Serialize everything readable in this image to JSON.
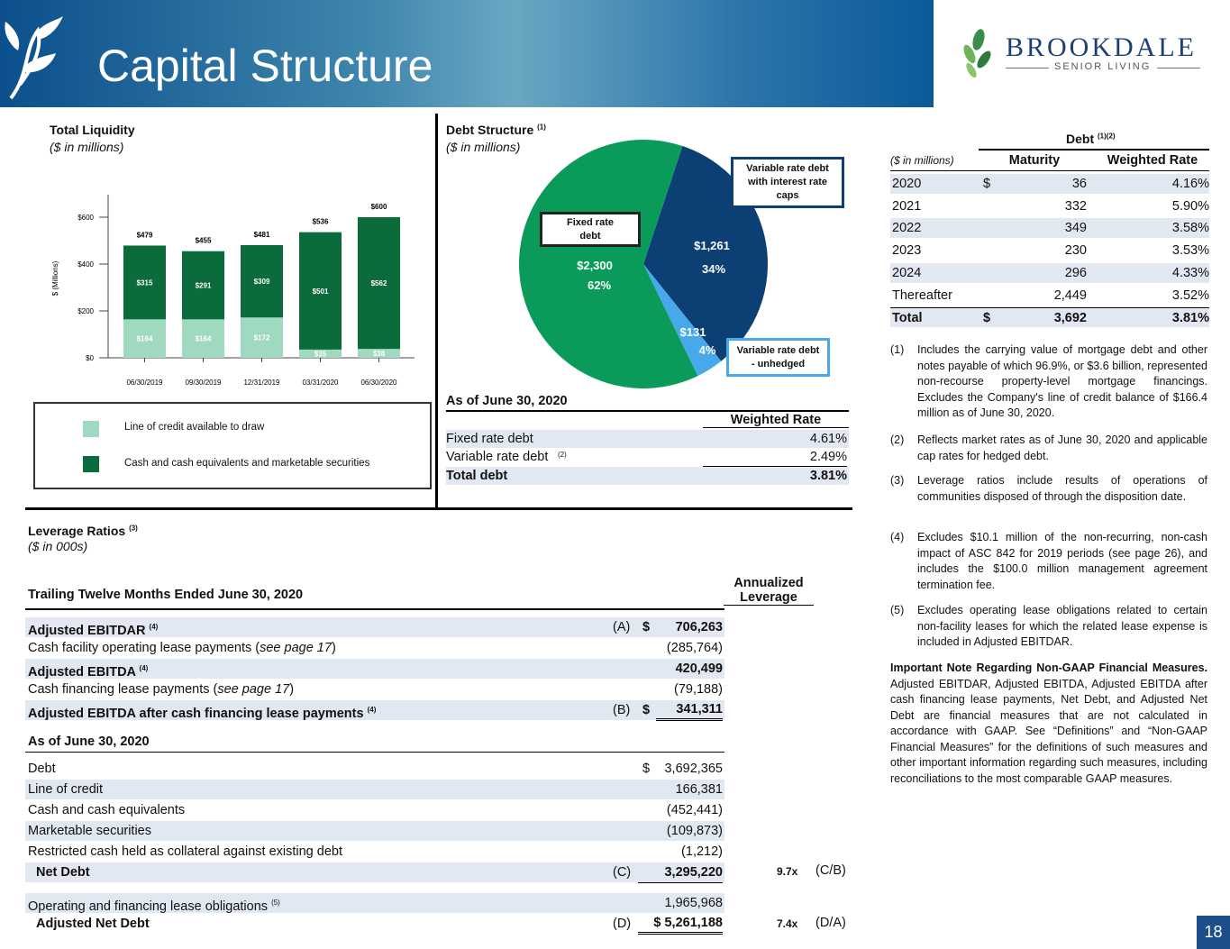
{
  "header": {
    "title": "Capital Structure",
    "brand_name": "BROOKDALE",
    "brand_sub": "SENIOR LIVING"
  },
  "liquidity": {
    "title": "Total Liquidity",
    "units": "($ in millions)",
    "legend_credit": "Line of credit available to draw",
    "legend_cash": "Cash and cash equivalents and marketable securities",
    "ylabel": "$ (Millions)"
  },
  "chart_data": [
    {
      "type": "bar",
      "title": "Total Liquidity",
      "ylabel": "$ (Millions)",
      "ylim": [
        0,
        600
      ],
      "yticks": [
        "$0",
        "$200",
        "$400",
        "$600"
      ],
      "categories": [
        "06/30/2019",
        "09/30/2019",
        "12/31/2019",
        "03/31/2020",
        "06/30/2020"
      ],
      "totals": [
        "$479",
        "$455",
        "$481",
        "$536",
        "$600"
      ],
      "total_values": [
        479,
        455,
        481,
        536,
        600
      ],
      "series": [
        {
          "name": "Line of credit available to draw",
          "values": [
            164,
            164,
            172,
            35,
            38
          ],
          "labels": [
            "$164",
            "$164",
            "$172",
            "$35",
            "$38"
          ],
          "color": "#9fd9bf"
        },
        {
          "name": "Cash and cash equivalents and marketable securities",
          "values": [
            315,
            291,
            309,
            501,
            562
          ],
          "labels": [
            "$315",
            "$291",
            "$309",
            "$501",
            "$562"
          ],
          "color": "#0b6b3a"
        }
      ],
      "stack_order": [
        "Line of credit available to draw",
        "Cash and cash equivalents and marketable securities"
      ]
    },
    {
      "type": "pie",
      "title": "Debt Structure",
      "slices": [
        {
          "name": "Fixed rate debt",
          "value": 2300,
          "label": "$2,300",
          "pct": "62%",
          "color": "#0a9b5a"
        },
        {
          "name": "Variable rate debt with interest rate caps",
          "value": 1261,
          "label": "$1,261",
          "pct": "34%",
          "color": "#0c3f73"
        },
        {
          "name": "Variable rate debt - unhedged",
          "value": 131,
          "label": "$131",
          "pct": "4%",
          "color": "#47a9ec"
        }
      ]
    }
  ],
  "debt_structure": {
    "title": "Debt Structure",
    "title_sup": "(1)",
    "units": "($ in millions)",
    "callout_caps": "Variable rate debt with interest rate caps",
    "callout_fixed": "Fixed rate debt",
    "callout_unhedged": "Variable rate debt - unhedged",
    "table_title": "As of June 30, 2020",
    "col": "Weighted Rate",
    "rows": [
      {
        "label": "Fixed rate debt",
        "sup": "",
        "value": "4.61%"
      },
      {
        "label": "Variable rate debt",
        "sup": "(2)",
        "value": "2.49%"
      },
      {
        "label": "Total debt",
        "sup": "",
        "value": "3.81%"
      }
    ]
  },
  "debt_table": {
    "title": "Debt",
    "title_sup": "(1)(2)",
    "units": "($ in millions)",
    "col_maturity": "Maturity",
    "col_rate": "Weighted Rate",
    "rows": [
      {
        "year": "2020",
        "dollar": "$",
        "maturity": "36",
        "rate": "4.16%"
      },
      {
        "year": "2021",
        "dollar": "",
        "maturity": "332",
        "rate": "5.90%"
      },
      {
        "year": "2022",
        "dollar": "",
        "maturity": "349",
        "rate": "3.58%"
      },
      {
        "year": "2023",
        "dollar": "",
        "maturity": "230",
        "rate": "3.53%"
      },
      {
        "year": "2024",
        "dollar": "",
        "maturity": "296",
        "rate": "4.33%"
      },
      {
        "year": "Thereafter",
        "dollar": "",
        "maturity": "2,449",
        "rate": "3.52%"
      },
      {
        "year": "Total",
        "dollar": "$",
        "maturity": "3,692",
        "rate": "3.81%"
      }
    ]
  },
  "notes": [
    {
      "num": "(1)",
      "text": "Includes the carrying value of mortgage debt and other notes payable of which 96.9%, or $3.6 billion, represented non-recourse property-level mortgage financings. Excludes the Company's line of credit balance of $166.4 million as of June 30, 2020."
    },
    {
      "num": "(2)",
      "text": "Reflects market rates as of June 30, 2020 and applicable cap rates for hedged debt."
    },
    {
      "num": "(3)",
      "text": "Leverage ratios include results of operations of communities disposed of through the disposition date."
    },
    {
      "num": "(4)",
      "text": "Excludes $10.1 million of the non-recurring, non-cash impact of ASC 842 for 2019 periods (see page 26), and includes the $100.0 million management agreement termination fee."
    },
    {
      "num": "(5)",
      "text": "Excludes operating lease obligations related to certain non-facility leases for which the related lease expense is included in Adjusted EBITDAR."
    }
  ],
  "important_note": {
    "heading": "Important Note Regarding Non-GAAP Financial Measures.",
    "text": " Adjusted EBITDAR, Adjusted EBITDA, Adjusted EBITDA after cash financing lease payments, Net Debt, and Adjusted Net Debt are financial measures that are not calculated in accordance with GAAP. See “Definitions” and “Non-GAAP Financial Measures” for the definitions of such measures and other important information regarding such measures, including reconciliations to the most comparable GAAP measures."
  },
  "leverage": {
    "title": "Leverage Ratios",
    "title_sup": "(3)",
    "units": "($ in 000s)",
    "ttm_heading": "Trailing Twelve Months Ended June 30, 2020",
    "col_annualized": "Annualized",
    "col_leverage": "Leverage",
    "rows1": [
      {
        "label": "Adjusted EBITDAR",
        "sup": "(4)",
        "ref": "(A)",
        "dollar": "$",
        "value": "706,263",
        "bold": true,
        "shade": true
      },
      {
        "label": "Cash facility operating lease payments (",
        "ital": "see page 17",
        "end": ")",
        "ref": "",
        "dollar": "",
        "value": "(285,764)",
        "bold": false,
        "shade": false
      },
      {
        "label": "Adjusted EBITDA",
        "sup": "(4)",
        "ref": "",
        "dollar": "",
        "value": "420,499",
        "bold": true,
        "shade": true
      },
      {
        "label": "Cash financing lease payments (",
        "ital": "see page 17",
        "end": ")",
        "ref": "",
        "dollar": "",
        "value": "(79,188)",
        "bold": false,
        "shade": false
      },
      {
        "label": "Adjusted EBITDA after cash financing lease payments",
        "sup": "(4)",
        "ref": "(B)",
        "dollar": "$",
        "value": "341,311",
        "bold": true,
        "shade": true
      }
    ],
    "asof_heading": "As of June 30, 2020",
    "rows2": [
      {
        "label": "Debt",
        "ref": "",
        "dollar": "$",
        "value": "3,692,365",
        "shade": false
      },
      {
        "label": "Line of credit",
        "ref": "",
        "dollar": "",
        "value": "166,381",
        "shade": true
      },
      {
        "label": "Cash and cash equivalents",
        "ref": "",
        "dollar": "",
        "value": "(452,441)",
        "shade": false
      },
      {
        "label": "Marketable securities",
        "ref": "",
        "dollar": "",
        "value": "(109,873)",
        "shade": true
      },
      {
        "label": "Restricted cash held as collateral against existing debt",
        "ref": "",
        "dollar": "",
        "value": "(1,212)",
        "shade": false
      }
    ],
    "net_debt": {
      "label": "Net Debt",
      "ref": "(C)",
      "value": "3,295,220",
      "lev": "9.7x",
      "lev_ref": "(C/B)"
    },
    "lease_obl": {
      "label": "Operating and financing lease obligations",
      "sup": "(5)",
      "value": "1,965,968"
    },
    "adj_net_debt": {
      "label": "Adjusted Net Debt",
      "ref": "(D)",
      "value": "$ 5,261,188",
      "lev": "7.4x",
      "lev_ref": "(D/A)"
    }
  },
  "page_number": "18"
}
